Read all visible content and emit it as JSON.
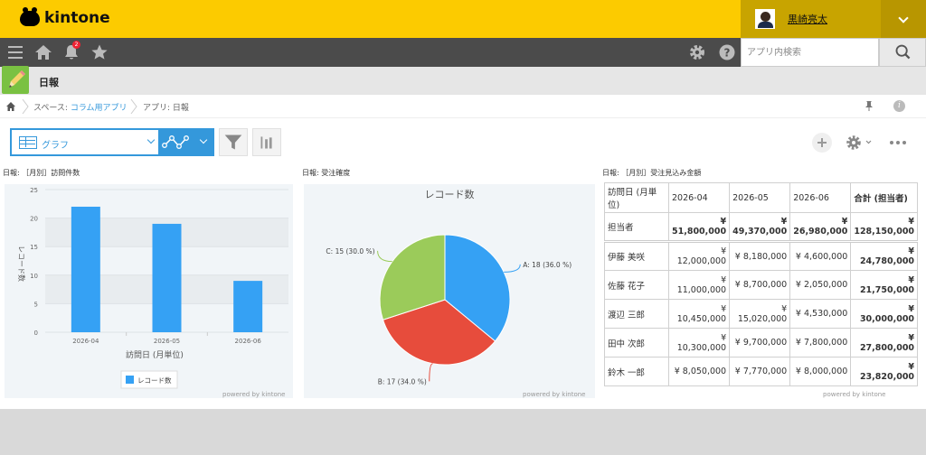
{
  "header": {
    "logo_text": "kintone",
    "user_name": "黒崎亮太"
  },
  "nav": {
    "notification_count": "2",
    "search_placeholder": "アプリ内検索"
  },
  "app": {
    "title": "日報"
  },
  "breadcrumb": {
    "space_prefix": "スペース: ",
    "space_name": "コラム用アプリ",
    "app_label": "アプリ: 日報"
  },
  "toolbar": {
    "view_label": "グラフ"
  },
  "panels": {
    "bar_title": "日報: ［月別］訪問件数",
    "pie_title": "日報: 受注確度",
    "table_title": "日報: ［月別］受注見込み金額",
    "powered_by": "powered by kintone"
  },
  "chart_data": [
    {
      "type": "bar",
      "categories": [
        "2026-04",
        "2026-05",
        "2026-06"
      ],
      "values": [
        22,
        19,
        9
      ],
      "xlabel": "訪問日 (月単位)",
      "ylabel": "レコード数",
      "ylim": [
        0,
        25
      ],
      "yticks": [
        "0",
        "5",
        "10",
        "15",
        "20",
        "25"
      ],
      "legend": "レコード数",
      "legend_position": "bottom",
      "color": "#35a1f4"
    },
    {
      "type": "pie",
      "title": "レコード数",
      "slices": [
        {
          "label": "A: 18 (36.0 %)",
          "value": 18,
          "color": "#35a1f4"
        },
        {
          "label": "B: 17 (34.0 %)",
          "value": 17,
          "color": "#e74c3c"
        },
        {
          "label": "C: 15 (30.0 %)",
          "value": 15,
          "color": "#9bcb5a"
        }
      ]
    },
    {
      "type": "table",
      "headers": [
        "訪問日 (月単位)",
        "2026-04",
        "2026-05",
        "2026-06",
        "合計 (担当者)"
      ],
      "total_row": {
        "label": "担当者",
        "values": [
          "¥ 51,800,000",
          "¥ 49,370,000",
          "¥ 26,980,000",
          "¥ 128,150,000"
        ]
      },
      "rows": [
        {
          "label": "伊藤 美咲",
          "values": [
            "¥ 12,000,000",
            "¥ 8,180,000",
            "¥ 4,600,000",
            "¥ 24,780,000"
          ]
        },
        {
          "label": "佐藤 花子",
          "values": [
            "¥ 11,000,000",
            "¥ 8,700,000",
            "¥ 2,050,000",
            "¥ 21,750,000"
          ]
        },
        {
          "label": "渡辺 三郎",
          "values": [
            "¥ 10,450,000",
            "¥ 15,020,000",
            "¥ 4,530,000",
            "¥ 30,000,000"
          ]
        },
        {
          "label": "田中 次郎",
          "values": [
            "¥ 10,300,000",
            "¥ 9,700,000",
            "¥ 7,800,000",
            "¥ 27,800,000"
          ]
        },
        {
          "label": "鈴木 一郎",
          "values": [
            "¥ 8,050,000",
            "¥ 7,770,000",
            "¥ 8,000,000",
            "¥ 23,820,000"
          ]
        }
      ]
    }
  ]
}
